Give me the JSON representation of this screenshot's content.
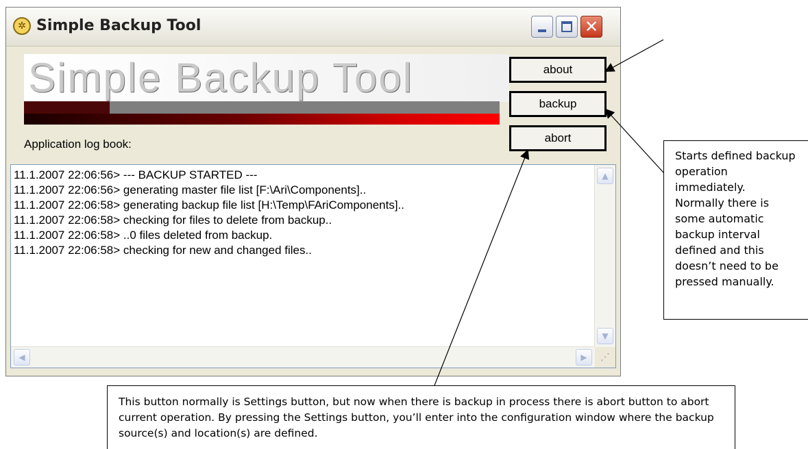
{
  "window": {
    "title": "Simple Backup Tool",
    "icon": "app-gear-icon",
    "controls": {
      "minimize": "minimize-icon",
      "maximize": "maximize-icon",
      "close": "close-icon"
    }
  },
  "banner": {
    "logo_text": "Simple Backup Tool",
    "progress_fraction": 0.18
  },
  "log": {
    "caption": "Application log book:",
    "lines": [
      "11.1.2007 22:06:56> --- BACKUP STARTED ---",
      "11.1.2007 22:06:56> generating master file list [F:\\Ari\\Components]..",
      "11.1.2007 22:06:58> generating backup file list [H:\\Temp\\FAriComponents]..",
      "11.1.2007 22:06:58> checking for files to delete from backup..",
      "11.1.2007 22:06:58> ..0 files deleted from backup.",
      "11.1.2007 22:06:58> checking for new and changed files.."
    ]
  },
  "buttons": {
    "about": "about",
    "backup": "backup",
    "abort": "abort"
  },
  "annotations": {
    "backup_note": "Starts defined backup operation immediately. Normally there is some automatic backup interval defined and this doesn’t need to be pressed manually.",
    "abort_note": "This button normally is Settings button, but now when there is backup in process there is abort button to abort current operation. By pressing the Settings button, you’ll enter into the configuration window where the backup source(s) and location(s) are defined."
  }
}
